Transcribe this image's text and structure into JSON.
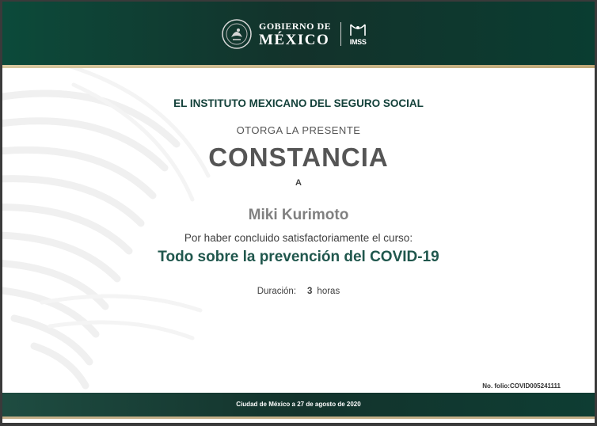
{
  "header": {
    "gobierno_small": "GOBIERNO DE",
    "gobierno_big": "MÉXICO",
    "imss_logo_text": "IMSS"
  },
  "certificate": {
    "institution": "EL INSTITUTO MEXICANO DEL SEGURO SOCIAL",
    "grants": "OTORGA LA PRESENTE",
    "title": "CONSTANCIA",
    "to": "A",
    "recipient": "Miki Kurimoto",
    "reason": "Por haber concluido satisfactoriamente el curso:",
    "course": "Todo sobre la prevención del COVID-19",
    "duration_label": "Duración:",
    "duration_value": "3",
    "duration_unit": "horas",
    "folio": "No. folio:COVID005241111"
  },
  "footer": {
    "place_date": "Ciudad de México a 27 de agosto de 2020"
  },
  "colors": {
    "header_green": "#13322b",
    "gold_accent": "#c4b089",
    "institution_green": "#13413a",
    "course_green": "#20574d"
  }
}
